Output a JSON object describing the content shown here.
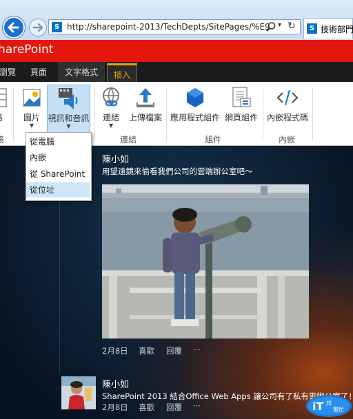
{
  "browser": {
    "url": "http://sharepoint-2013/TechDepts/SitePages/%E9",
    "tab_title": "技術部門"
  },
  "suite": {
    "brand": "harePoint"
  },
  "ribbon_tabs": [
    "瀏覽",
    "頁面",
    "文字格式",
    "插入"
  ],
  "ribbon": {
    "buttons": {
      "table": "格",
      "picture": "圖片",
      "video_audio": "視訊和音訊",
      "link": "連結",
      "upload": "上傳檔案",
      "app_part": "應用程式組件",
      "web_part": "網頁組件",
      "embed_code": "內嵌程式碼"
    },
    "groups": {
      "first": "格",
      "links": "連結",
      "parts": "組件",
      "embed": "內嵌"
    }
  },
  "menu": {
    "items": [
      "從電腦",
      "內嵌",
      "從 SharePoint",
      "從位址"
    ],
    "selected": "從位址"
  },
  "posts": [
    {
      "author": "陳小如",
      "text": "用望遠鏡來偷看我們公司的雲端辦公室吧～",
      "date": "2月8日",
      "like": "喜歡",
      "reply": "回覆",
      "more": "···"
    },
    {
      "author": "陳小如",
      "text": "SharePoint 2013 結合Office Web Apps 讓公司有了私有雲辦公室了！",
      "date": "2月8日",
      "like": "喜歡",
      "reply": "回覆",
      "more": "···"
    }
  ],
  "watermark": {
    "text": "iT邦幫忙"
  },
  "colors": {
    "suite_red": "#e3170d",
    "tab_accent": "#f6a11a",
    "selected_item": "#cde6f7"
  }
}
